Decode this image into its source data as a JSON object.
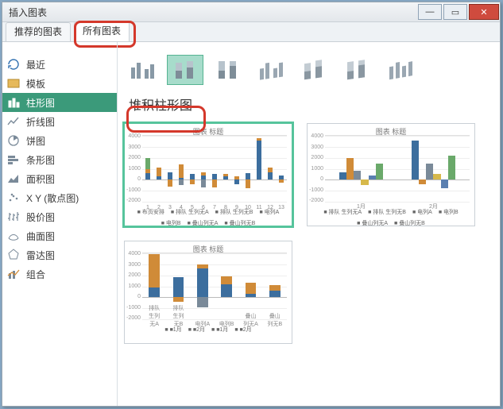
{
  "window": {
    "title": "插入图表"
  },
  "tabs": {
    "recommended": "推荐的图表",
    "all": "所有图表"
  },
  "sidebar": {
    "items": [
      {
        "label": "最近",
        "icon": "recent-icon"
      },
      {
        "label": "模板",
        "icon": "template-icon"
      },
      {
        "label": "柱形图",
        "icon": "column-chart-icon"
      },
      {
        "label": "折线图",
        "icon": "line-chart-icon"
      },
      {
        "label": "饼图",
        "icon": "pie-chart-icon"
      },
      {
        "label": "条形图",
        "icon": "bar-chart-icon"
      },
      {
        "label": "面积图",
        "icon": "area-chart-icon"
      },
      {
        "label": "X Y (散点图)",
        "icon": "scatter-chart-icon"
      },
      {
        "label": "股价图",
        "icon": "stock-chart-icon"
      },
      {
        "label": "曲面图",
        "icon": "surface-chart-icon"
      },
      {
        "label": "雷达图",
        "icon": "radar-chart-icon"
      },
      {
        "label": "组合",
        "icon": "combo-chart-icon"
      }
    ],
    "selected_index": 2
  },
  "subtype": {
    "title": "堆积柱形图",
    "selected_index": 1
  },
  "previews": {
    "sample_title": "图表 标题",
    "selected": 0,
    "legend1": [
      "布页安排",
      "排队 生列无A",
      "排队 生列无B",
      "电列A",
      "电列B",
      "叠山列无A",
      "叠山列无B"
    ],
    "legend2": [
      "排队 生列无A",
      "排队 生列无B",
      "电列A",
      "电列B",
      "叠山列无A",
      "叠山列无B"
    ],
    "legend3": [
      "■1月",
      "■2月",
      "■1月",
      "■2月"
    ]
  },
  "chart_data": [
    {
      "type": "bar",
      "stacked": true,
      "title": "图表 标题",
      "yticks": [
        4000,
        3000,
        2000,
        1000,
        0,
        -1000,
        -2000
      ],
      "ylim": [
        -2000,
        4000
      ],
      "categories": [
        "1",
        "2",
        "3",
        "4",
        "5",
        "6",
        "7",
        "8",
        "9",
        "10",
        "11",
        "12",
        "13"
      ],
      "series": [
        {
          "name": "布页安排",
          "color": "#3c6e9e",
          "values": [
            600,
            300,
            700,
            200,
            500,
            400,
            500,
            300,
            -400,
            600,
            3600,
            700,
            400
          ]
        },
        {
          "name": "排队 生列无A",
          "color": "#d08b38",
          "values": [
            400,
            800,
            -600,
            1200,
            -400,
            300,
            -700,
            200,
            300,
            -800,
            200,
            400,
            -300
          ]
        },
        {
          "name": "排队 生列无B",
          "color": "#7a8a99",
          "values": [
            0,
            0,
            0,
            -500,
            0,
            -700,
            0,
            0,
            0,
            0,
            0,
            0,
            0
          ]
        },
        {
          "name": "电列A",
          "color": "#d7b94b",
          "values": [
            0,
            0,
            0,
            0,
            0,
            0,
            0,
            0,
            0,
            0,
            0,
            0,
            0
          ]
        },
        {
          "name": "电列B",
          "color": "#5a7fb0",
          "values": [
            0,
            0,
            0,
            0,
            0,
            0,
            0,
            0,
            0,
            0,
            0,
            0,
            0
          ]
        },
        {
          "name": "叠山列无A",
          "color": "#6aa96a",
          "values": [
            1000,
            0,
            0,
            0,
            0,
            0,
            0,
            0,
            0,
            0,
            0,
            0,
            0
          ]
        },
        {
          "name": "叠山列无B",
          "color": "#4c88b5",
          "values": [
            0,
            0,
            0,
            0,
            0,
            0,
            0,
            0,
            0,
            0,
            0,
            0,
            0
          ]
        }
      ]
    },
    {
      "type": "bar",
      "stacked": false,
      "grouped": true,
      "title": "图表 标题",
      "yticks": [
        4000,
        3000,
        2000,
        1000,
        0,
        -1000,
        -2000
      ],
      "ylim": [
        -2000,
        4000
      ],
      "categories": [
        "1月",
        "2月"
      ],
      "series": [
        {
          "name": "排队 生列无A",
          "color": "#3c6e9e",
          "values": [
            700,
            3600
          ]
        },
        {
          "name": "排队 生列无B",
          "color": "#d08b38",
          "values": [
            2000,
            -400
          ]
        },
        {
          "name": "电列A",
          "color": "#7a8a99",
          "values": [
            800,
            1500
          ]
        },
        {
          "name": "电列B",
          "color": "#d7b94b",
          "values": [
            -500,
            500
          ]
        },
        {
          "name": "叠山列无A",
          "color": "#5a7fb0",
          "values": [
            400,
            -800
          ]
        },
        {
          "name": "叠山列无B",
          "color": "#6aa96a",
          "values": [
            1500,
            2200
          ]
        }
      ]
    },
    {
      "type": "bar",
      "stacked": true,
      "title": "图表 标题",
      "yticks": [
        4000,
        3000,
        2000,
        1000,
        0,
        -1000,
        -2000
      ],
      "ylim": [
        -2000,
        4000
      ],
      "categories": [
        "排队 生列无A",
        "排队 生列无B",
        "电列A",
        "电列B",
        "叠山列无A",
        "叠山列无B"
      ],
      "series": [
        {
          "name": "1月",
          "color": "#3c6e9e",
          "values": [
            900,
            1800,
            2600,
            1200,
            300,
            600
          ]
        },
        {
          "name": "2月",
          "color": "#d08b38",
          "values": [
            3000,
            -400,
            400,
            700,
            1000,
            500
          ]
        },
        {
          "name": "1月b",
          "color": "#7a8a99",
          "values": [
            0,
            0,
            -900,
            0,
            0,
            0
          ]
        },
        {
          "name": "2月b",
          "color": "#d7b94b",
          "values": [
            0,
            0,
            0,
            0,
            0,
            0
          ]
        }
      ]
    }
  ]
}
